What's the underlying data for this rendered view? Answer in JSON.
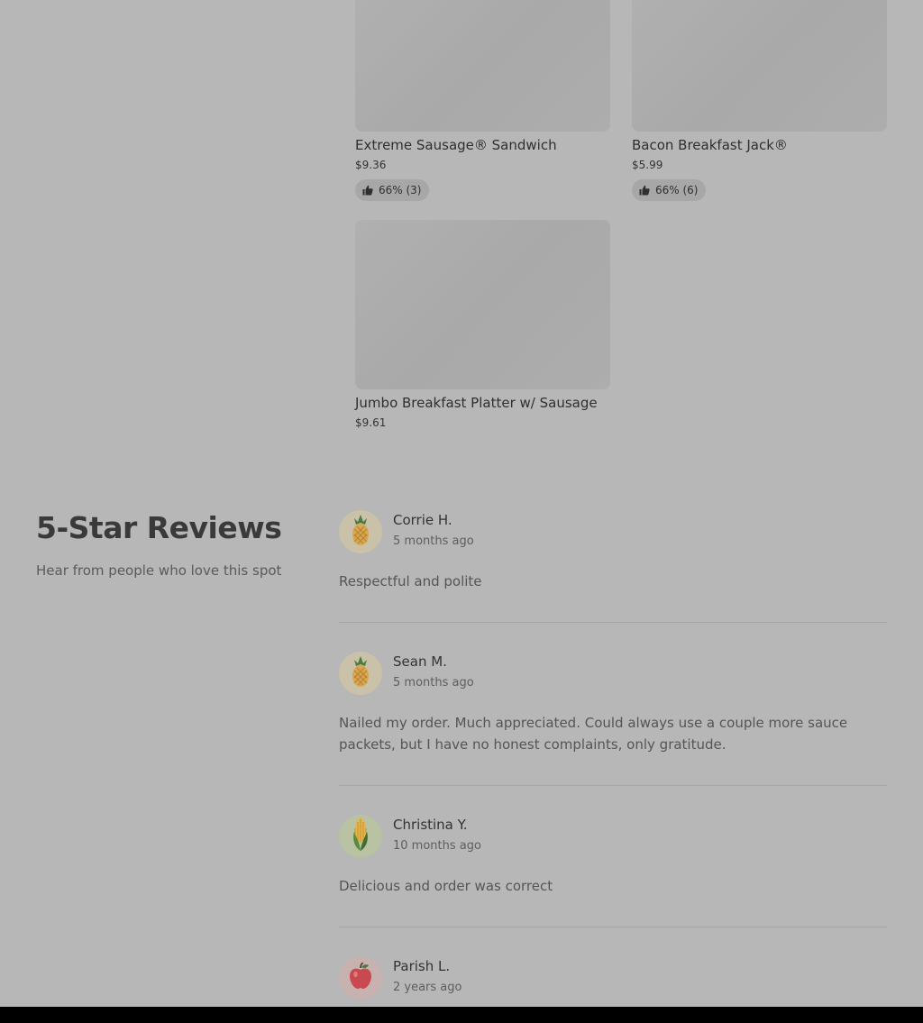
{
  "menu_items": [
    {
      "name": "Extreme Sausage® Sandwich",
      "price": "$9.36",
      "rating": "66% (3)"
    },
    {
      "name": "Bacon Breakfast Jack®",
      "price": "$5.99",
      "rating": "66% (6)"
    },
    {
      "name": "Jumbo Breakfast Platter w/ Sausage",
      "price": "$9.61"
    }
  ],
  "reviews_section": {
    "title": "5-Star Reviews",
    "subtitle": "Hear from people who love this spot"
  },
  "reviews": [
    {
      "name": "Corrie H.",
      "time": "5 months ago",
      "text": "Respectful and polite",
      "avatar_icon": "pineapple-icon"
    },
    {
      "name": "Sean M.",
      "time": "5 months ago",
      "text": "Nailed my order. Much appreciated. Could always use a couple more sauce packets, but I have no honest complaints, only gratitude.",
      "avatar_icon": "pineapple-icon"
    },
    {
      "name": "Christina Y.",
      "time": "10 months ago",
      "text": "Delicious and order was correct",
      "avatar_icon": "corn-icon"
    },
    {
      "name": "Parish L.",
      "time": "2 years ago",
      "avatar_icon": "apple-icon"
    }
  ],
  "colors": {
    "overlay_background": "#b7b7b7",
    "avatar_pineapple_bg": "#c9c1a8",
    "avatar_corn_bg": "#b9c2a2",
    "avatar_apple_bg": "#c7b2b0"
  }
}
